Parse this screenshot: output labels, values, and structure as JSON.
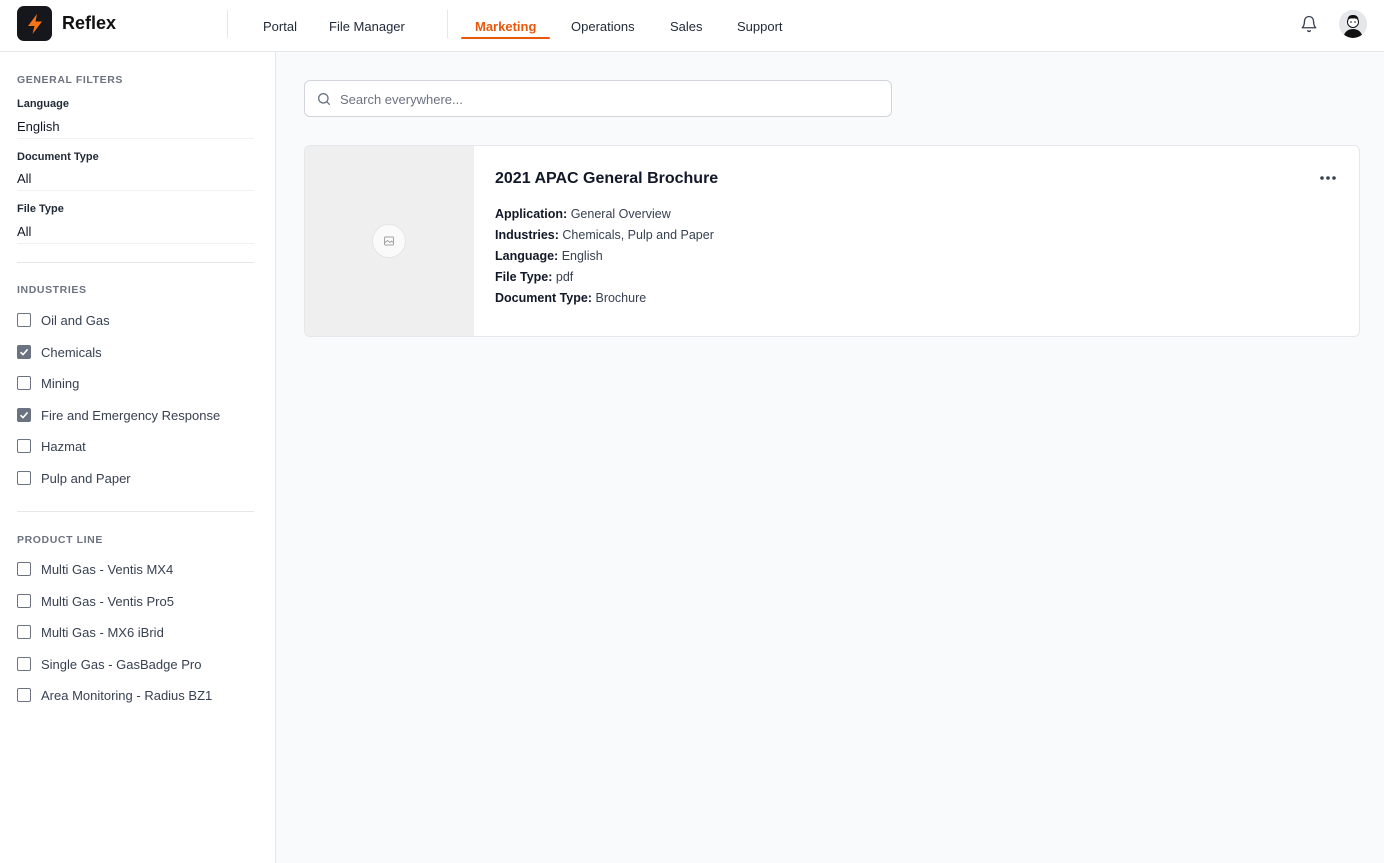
{
  "header": {
    "brand": "Reflex",
    "nav": [
      "Portal",
      "File Manager",
      "Marketing",
      "Operations",
      "Sales",
      "Support"
    ],
    "active_nav": "Marketing",
    "accent": "#ea580c"
  },
  "sidebar": {
    "general_filters": {
      "title": "GENERAL FILTERS",
      "fields": [
        {
          "label": "Language",
          "value": "English"
        },
        {
          "label": "Document Type",
          "value": "All"
        },
        {
          "label": "File Type",
          "value": "All"
        }
      ]
    },
    "industries": {
      "title": "INDUSTRIES",
      "items": [
        {
          "label": "Oil and Gas",
          "checked": false
        },
        {
          "label": "Chemicals",
          "checked": true
        },
        {
          "label": "Mining",
          "checked": false
        },
        {
          "label": "Fire and Emergency Response",
          "checked": true
        },
        {
          "label": "Hazmat",
          "checked": false
        },
        {
          "label": "Pulp and Paper",
          "checked": false
        }
      ]
    },
    "product_line": {
      "title": "PRODUCT LINE",
      "items": [
        {
          "label": "Multi Gas - Ventis MX4",
          "checked": false
        },
        {
          "label": "Multi Gas - Ventis Pro5",
          "checked": false
        },
        {
          "label": "Multi Gas - MX6 iBrid",
          "checked": false
        },
        {
          "label": "Single Gas - GasBadge Pro",
          "checked": false
        },
        {
          "label": "Area Monitoring - Radius BZ1",
          "checked": false
        }
      ]
    }
  },
  "search": {
    "placeholder": "Search everywhere..."
  },
  "card": {
    "title": "2021 APAC General Brochure",
    "meta": [
      {
        "key": "Application:",
        "value": "General Overview"
      },
      {
        "key": "Industries:",
        "value": "Chemicals, Pulp and Paper"
      },
      {
        "key": "Language:",
        "value": "English"
      },
      {
        "key": "File Type:",
        "value": "pdf"
      },
      {
        "key": "Document Type:",
        "value": "Brochure"
      }
    ]
  }
}
